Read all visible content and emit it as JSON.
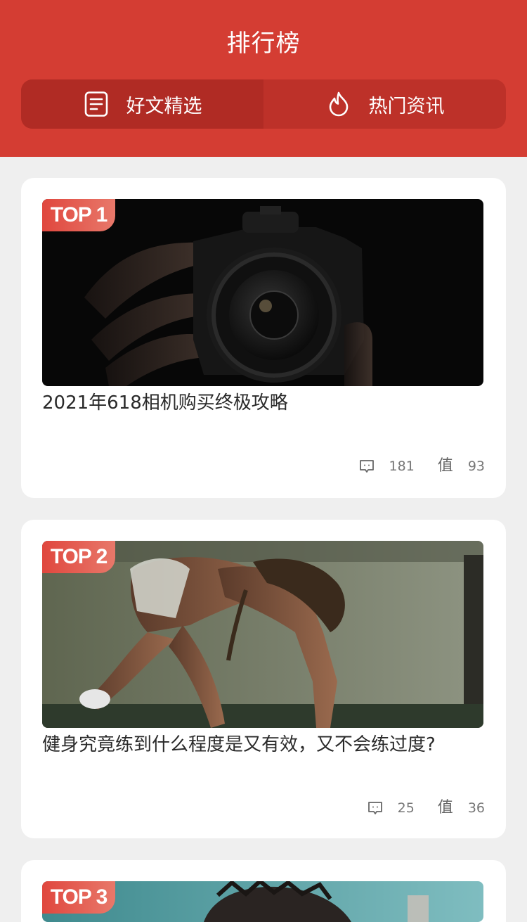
{
  "header": {
    "title": "排行榜",
    "tabs": [
      {
        "label": "好文精选",
        "icon": "article-icon",
        "active": true
      },
      {
        "label": "热门资讯",
        "icon": "flame-icon",
        "active": false
      }
    ]
  },
  "articles": [
    {
      "rank": "TOP 1",
      "title": "2021年618相机购买终极攻略",
      "image": "camera-photo",
      "comments": "181",
      "worth_icon": "值",
      "worth": "93"
    },
    {
      "rank": "TOP 2",
      "title": "健身究竟练到什么程度是又有效，又不会练过度?",
      "image": "fitness-photo",
      "comments": "25",
      "worth_icon": "值",
      "worth": "36"
    },
    {
      "rank": "TOP 3",
      "image": "anime-photo"
    }
  ],
  "colors": {
    "brand": "#d43d33",
    "badge": "#e0473e"
  }
}
